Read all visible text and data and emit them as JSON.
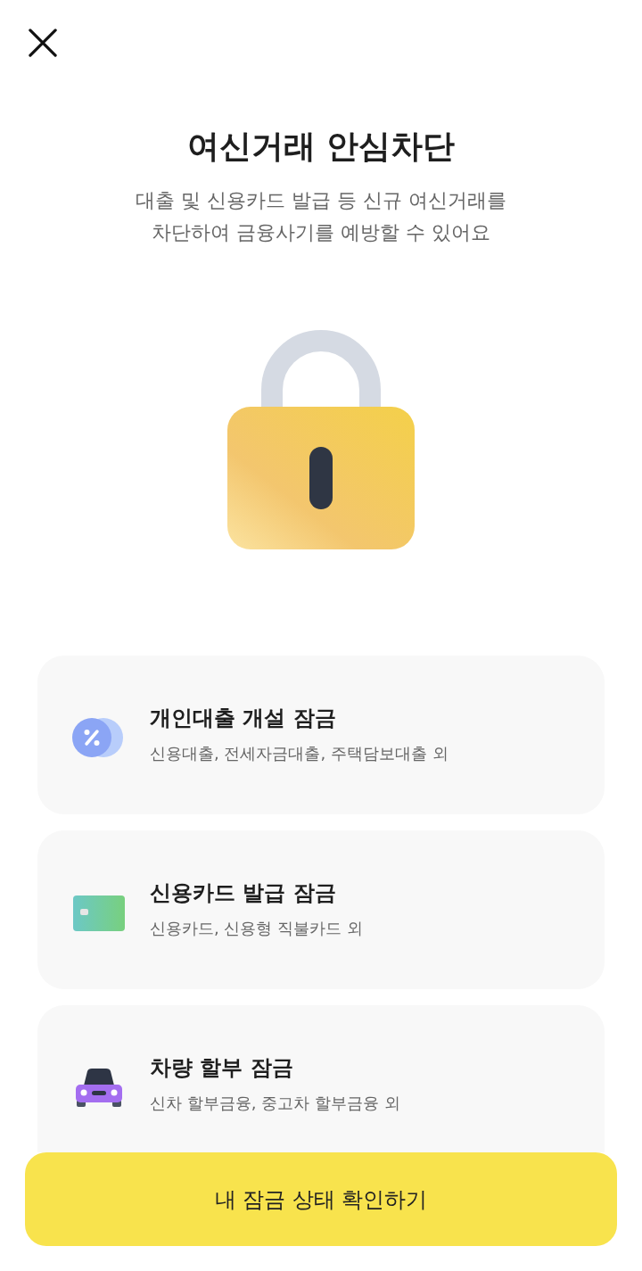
{
  "title": "여신거래 안심차단",
  "subtitle_lines": [
    "대출 및 신용카드 발급 등 신규 여신거래를",
    "차단하여 금융사기를 예방할 수 있어요"
  ],
  "lock_items": [
    {
      "kind": "loan",
      "title": "개인대출 개설 잠금",
      "description": "신용대출, 전세자금대출, 주택담보대출 외"
    },
    {
      "kind": "card",
      "title": "신용카드 발급 잠금",
      "description": "신용카드, 신용형 직불카드 외"
    },
    {
      "kind": "car",
      "title": "차량 할부 잠금",
      "description": "신차 할부금융, 중고차 할부금융 외"
    }
  ],
  "primary_button": {
    "label": "내 잠금 상태 확인하기"
  }
}
